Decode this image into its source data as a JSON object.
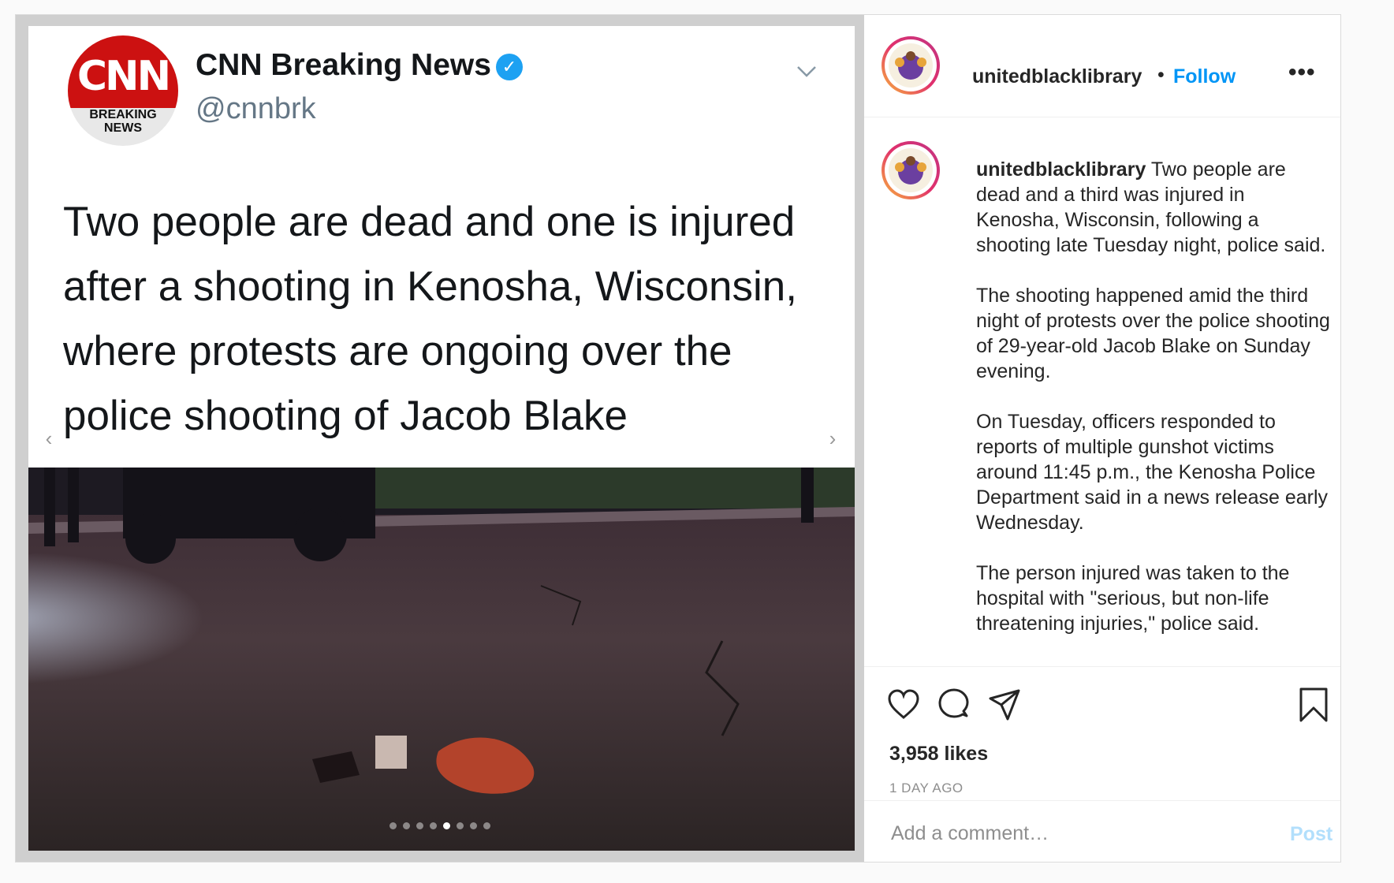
{
  "post": {
    "media": {
      "tweet": {
        "logo": {
          "letters": "CNN",
          "sub_line1": "BREAKING",
          "sub_line2": "NEWS"
        },
        "name": "CNN Breaking News",
        "handle": "@cnnbrk",
        "text": "Two people are dead and one is injured after a shooting in Kenosha, Wisconsin, where protests are ongoing over the police shooting of Jacob Blake"
      },
      "carousel": {
        "total": 8,
        "active_index": 4
      },
      "nav": {
        "prev": "‹",
        "next": "›"
      }
    },
    "header": {
      "username": "unitedblacklibrary",
      "separator": "•",
      "follow_label": "Follow",
      "more_label": "•••"
    },
    "caption": {
      "username": "unitedblacklibrary",
      "paragraphs": [
        "Two people are dead and a third was injured in Kenosha, Wisconsin, following a shooting late Tuesday night, police said.",
        "The shooting happened amid the third night of protests over the police shooting of 29-year-old Jacob Blake on Sunday evening.",
        "On Tuesday, officers responded to reports of multiple gunshot victims around 11:45 p.m., the Kenosha Police Department said in a news release early Wednesday.",
        "The person injured was taken to the hospital with \"serious, but non-life threatening injuries,\" police said."
      ]
    },
    "actions": {
      "icons": [
        "heart-icon",
        "comment-icon",
        "share-icon",
        "bookmark-icon"
      ],
      "likes": "3,958 likes",
      "time_ago": "1 DAY AGO"
    },
    "comment": {
      "placeholder": "Add a comment…",
      "post_label": "Post"
    },
    "colors": {
      "link_blue": "#0095f6",
      "post_disabled": "#b2dffc",
      "cnn_red": "#cc1111",
      "verified_blue": "#1da1f2"
    }
  }
}
